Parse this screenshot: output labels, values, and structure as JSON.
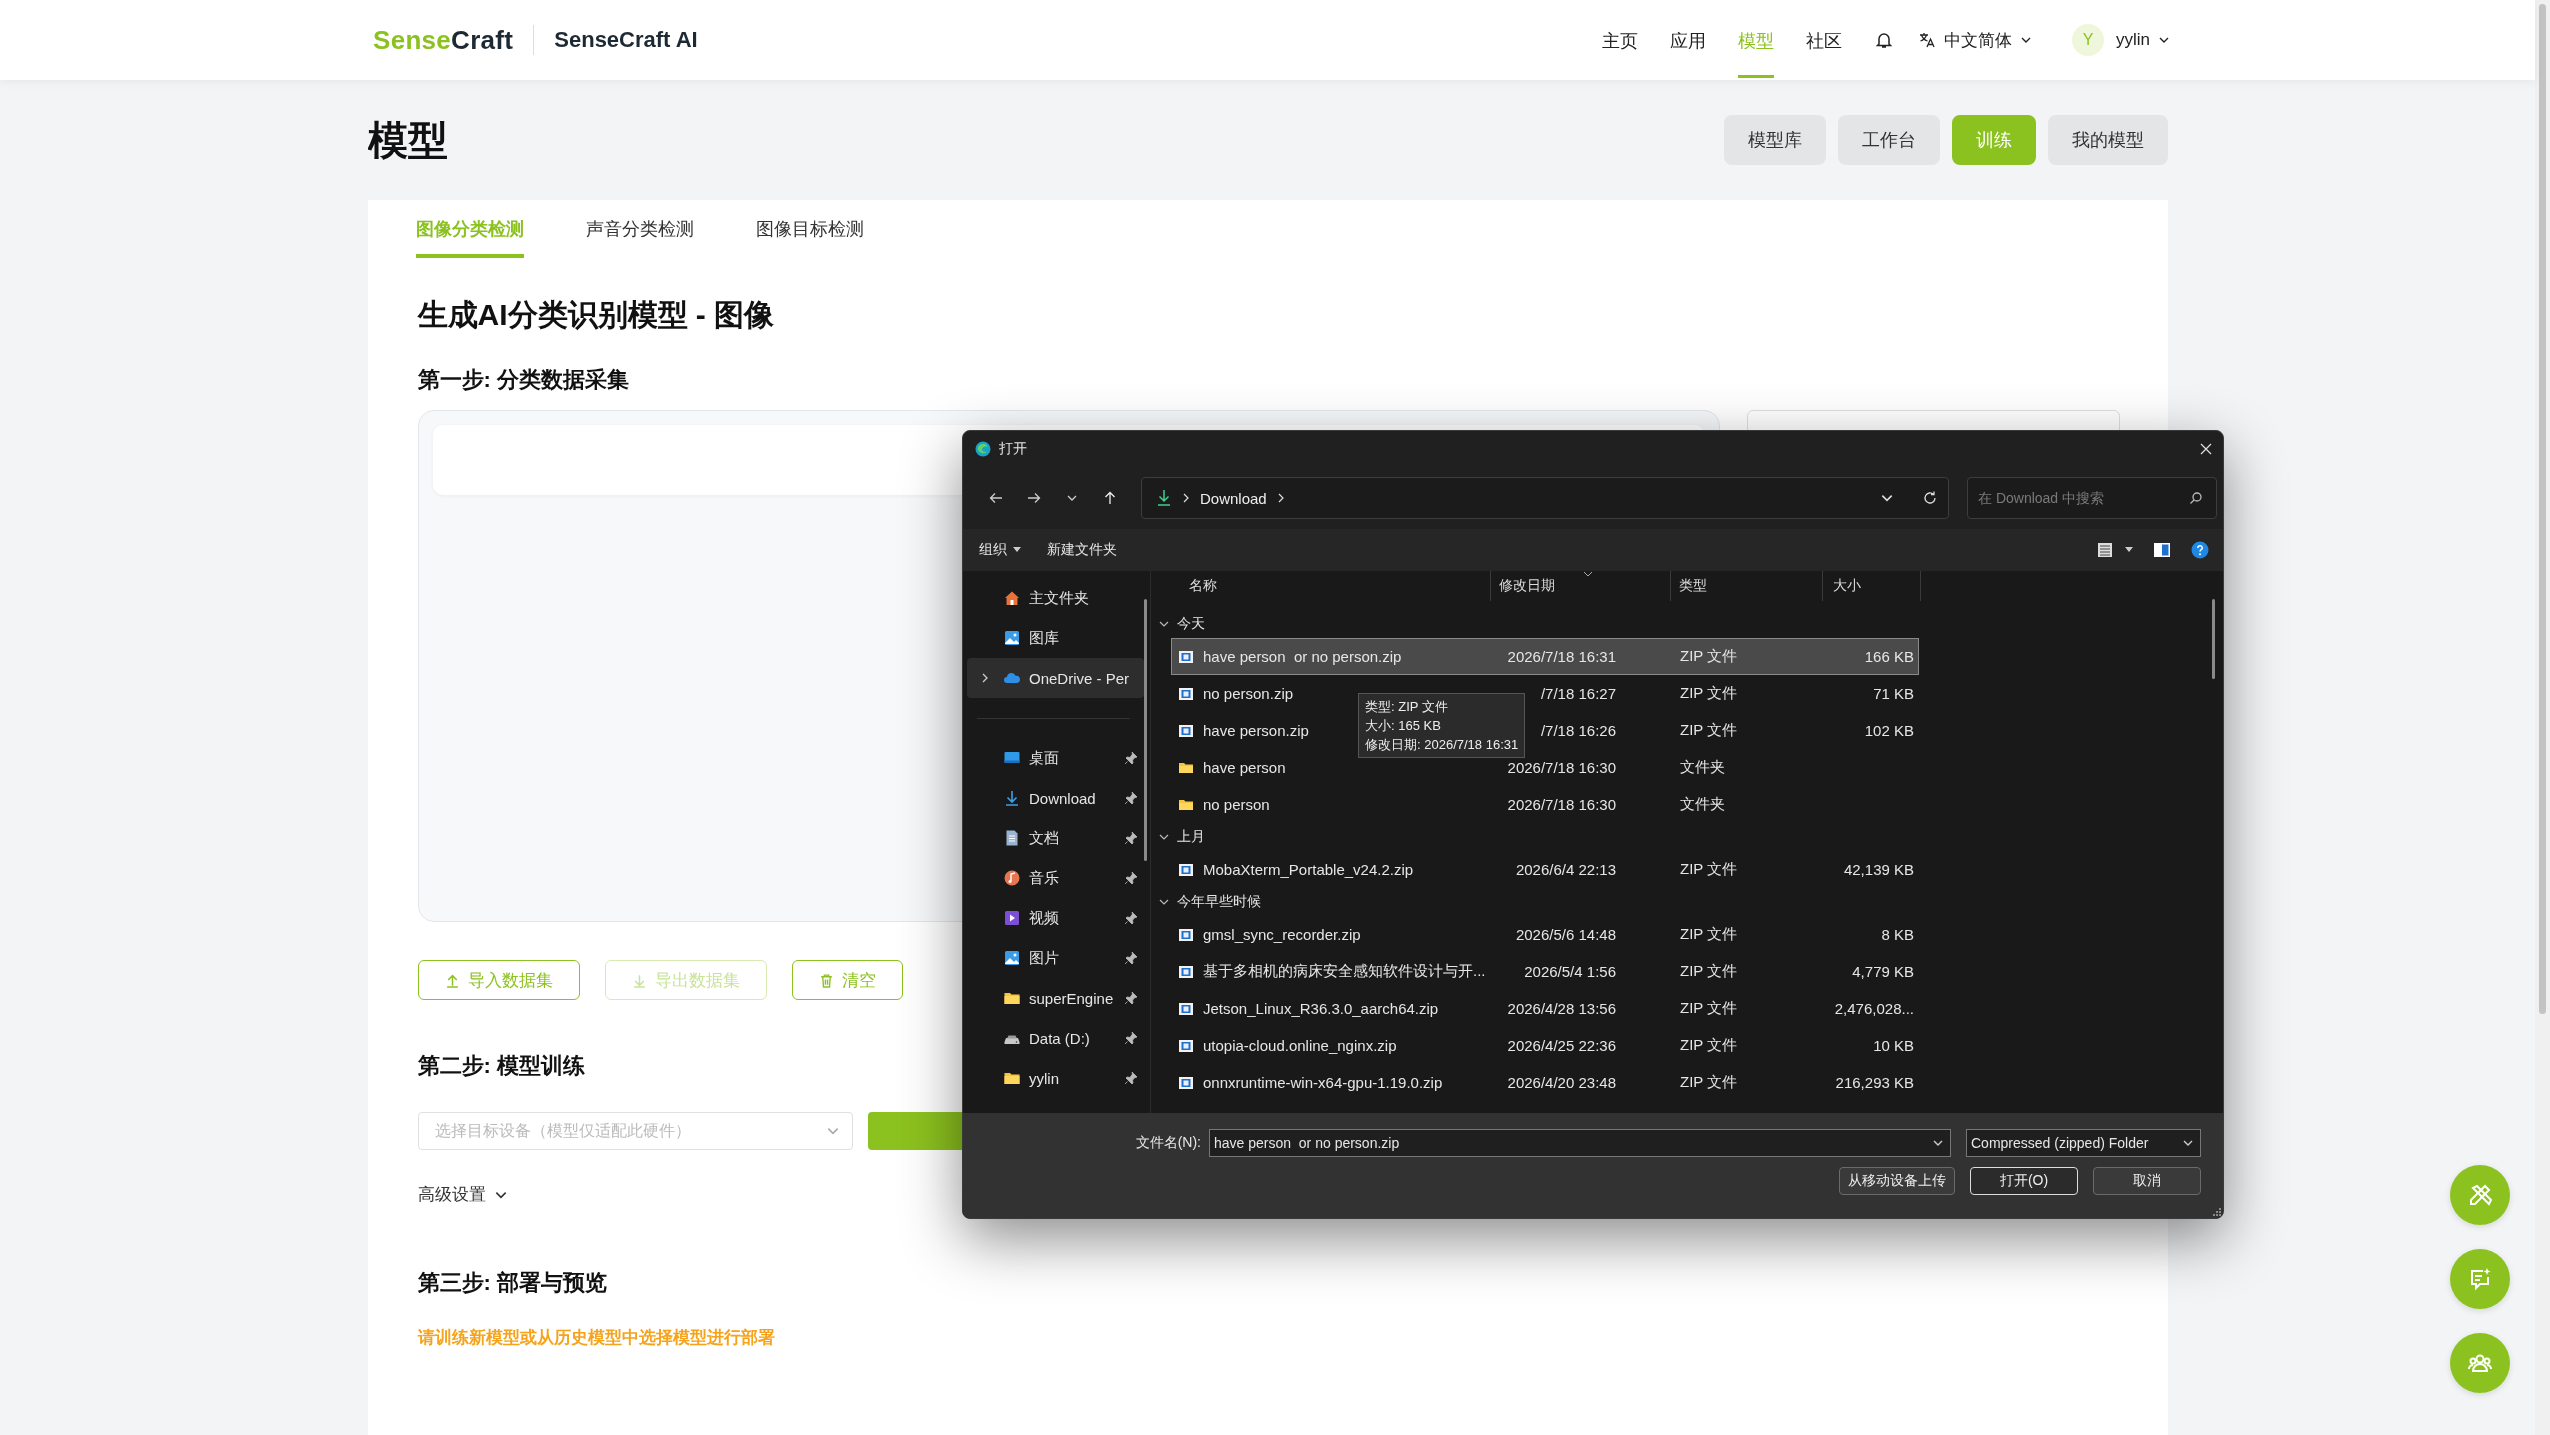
{
  "header": {
    "logo_parts": [
      {
        "text": "Sense",
        "color": "#8cc21f"
      },
      {
        "text": "Craft",
        "color": "#1e2a33"
      }
    ],
    "product": "SenseCraft AI",
    "nav": [
      {
        "label": "主页",
        "selected": false
      },
      {
        "label": "应用",
        "selected": false
      },
      {
        "label": "模型",
        "selected": true
      },
      {
        "label": "社区",
        "selected": false
      }
    ],
    "language": "中文简体",
    "avatar": "Y",
    "user": "yylin"
  },
  "page": {
    "title": "模型",
    "buttons": [
      {
        "label": "模型库",
        "selected": false
      },
      {
        "label": "工作台",
        "selected": false
      },
      {
        "label": "训练",
        "selected": true
      },
      {
        "label": "我的模型",
        "selected": false
      }
    ]
  },
  "tabs": [
    {
      "label": "图像分类检测",
      "selected": true
    },
    {
      "label": "声音分类检测",
      "selected": false
    },
    {
      "label": "图像目标检测",
      "selected": false
    }
  ],
  "heading": "生成AI分类识别模型 - 图像",
  "step1": {
    "title": "第一步: 分类数据采集",
    "buttons": [
      {
        "label": "导入数据集",
        "kind": "import",
        "disabled": false
      },
      {
        "label": "导出数据集",
        "kind": "export",
        "disabled": true
      },
      {
        "label": "清空",
        "kind": "clear",
        "disabled": false
      }
    ]
  },
  "step2": {
    "title": "第二步: 模型训练",
    "device_select": {
      "placeholder": "选择目标设备（模型仅适配此硬件）"
    },
    "advanced": "高级设置"
  },
  "step3": {
    "title": "第三步: 部署与预览",
    "notice": "请训练新模型或从历史模型中选择模型进行部署"
  },
  "dialog": {
    "title": "打开",
    "path": "Download",
    "search_placeholder": "在 Download 中搜索",
    "toolbar": [
      "组织",
      "新建文件夹"
    ],
    "sidebar": [
      {
        "label": "主文件夹",
        "kind": "home",
        "pinned": false,
        "expandable": false,
        "selected": false
      },
      {
        "label": "图库",
        "kind": "gallery",
        "pinned": false,
        "expandable": false,
        "selected": false
      },
      {
        "label": "OneDrive - Per",
        "kind": "cloud",
        "pinned": false,
        "expandable": true,
        "selected": true
      },
      {
        "label": "桌面",
        "kind": "desktop",
        "pinned": true,
        "expandable": false,
        "selected": false
      },
      {
        "label": "Download",
        "kind": "download",
        "pinned": true,
        "expandable": false,
        "selected": false
      },
      {
        "label": "文档",
        "kind": "document",
        "pinned": true,
        "expandable": false,
        "selected": false
      },
      {
        "label": "音乐",
        "kind": "music",
        "pinned": true,
        "expandable": false,
        "selected": false
      },
      {
        "label": "视频",
        "kind": "video",
        "pinned": true,
        "expandable": false,
        "selected": false
      },
      {
        "label": "图片",
        "kind": "gallery",
        "pinned": true,
        "expandable": false,
        "selected": false
      },
      {
        "label": "superEngine",
        "kind": "folder",
        "pinned": true,
        "expandable": false,
        "selected": false
      },
      {
        "label": "Data (D:)",
        "kind": "drive",
        "pinned": true,
        "expandable": false,
        "selected": false
      },
      {
        "label": "yylin",
        "kind": "folder",
        "pinned": true,
        "expandable": false,
        "selected": false
      }
    ],
    "columns": [
      "名称",
      "修改日期",
      "类型",
      "大小"
    ],
    "groups": [
      {
        "label": "今天",
        "expanded": true,
        "files": [
          {
            "name": "have person  or no person.zip",
            "date": "2026/7/18 16:31",
            "type": "ZIP 文件",
            "size": "166 KB",
            "kind": "zip",
            "selected": true
          },
          {
            "name": "no person.zip",
            "date": "/7/18 16:27",
            "type": "ZIP 文件",
            "size": "71 KB",
            "kind": "zip",
            "selected": false
          },
          {
            "name": "have person.zip",
            "date": "/7/18 16:26",
            "type": "ZIP 文件",
            "size": "102 KB",
            "kind": "zip",
            "selected": false
          },
          {
            "name": "have person",
            "date": "2026/7/18 16:30",
            "type": "文件夹",
            "kind": "folder",
            "selected": false
          },
          {
            "name": "no person",
            "date": "2026/7/18 16:30",
            "type": "文件夹",
            "kind": "folder",
            "selected": false
          }
        ]
      },
      {
        "label": "上月",
        "expanded": true,
        "files": [
          {
            "name": "MobaXterm_Portable_v24.2.zip",
            "date": "2026/6/4 22:13",
            "type": "ZIP 文件",
            "size": "42,139 KB",
            "kind": "zip",
            "selected": false
          }
        ]
      },
      {
        "label": "今年早些时候",
        "expanded": true,
        "files": [
          {
            "name": "gmsl_sync_recorder.zip",
            "date": "2026/5/6 14:48",
            "type": "ZIP 文件",
            "size": "8 KB",
            "kind": "zip",
            "selected": false
          },
          {
            "name": "基于多相机的病床安全感知软件设计与开...",
            "date": "2026/5/4 1:56",
            "type": "ZIP 文件",
            "size": "4,779 KB",
            "kind": "zip",
            "selected": false
          },
          {
            "name": "Jetson_Linux_R36.3.0_aarch64.zip",
            "date": "2026/4/28 13:56",
            "type": "ZIP 文件",
            "size": "2,476,028...",
            "kind": "zip",
            "selected": false
          },
          {
            "name": "utopia-cloud.online_nginx.zip",
            "date": "2026/4/25 22:36",
            "type": "ZIP 文件",
            "size": "10 KB",
            "kind": "zip",
            "selected": false
          },
          {
            "name": "onnxruntime-win-x64-gpu-1.19.0.zip",
            "date": "2026/4/20 23:48",
            "type": "ZIP 文件",
            "size": "216,293 KB",
            "kind": "zip",
            "selected": false
          }
        ]
      }
    ],
    "tooltip": [
      "类型: ZIP 文件",
      "大小: 165 KB",
      "修改日期: 2026/7/18 16:31"
    ],
    "filename_label": "文件名(N):",
    "filename": "have person  or no person.zip",
    "filter": "Compressed (zipped) Folder",
    "buttons": [
      "从移动设备上传",
      "打开(O)",
      "取消"
    ]
  }
}
